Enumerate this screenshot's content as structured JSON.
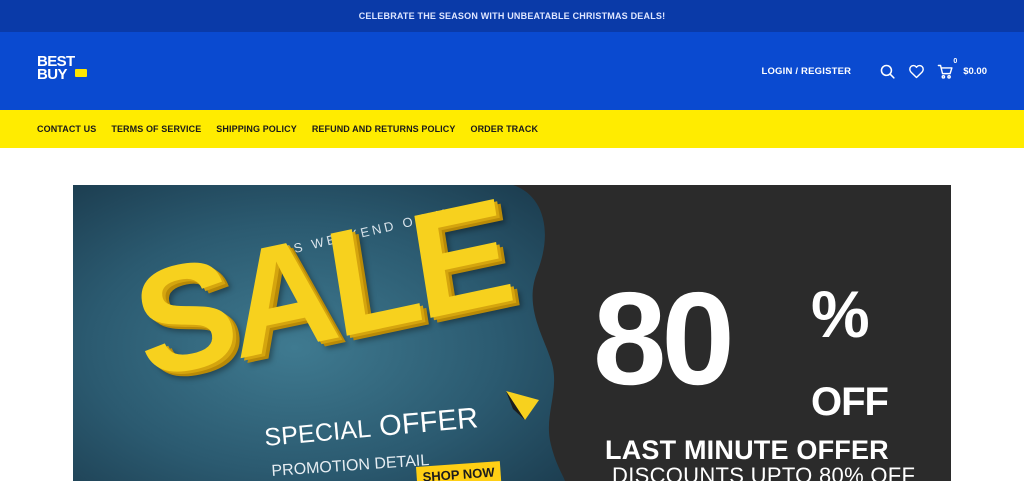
{
  "announcement": "CELEBRATE THE SEASON WITH UNBEATABLE CHRISTMAS DEALS!",
  "logo": {
    "line1": "BEST",
    "line2": "BUY"
  },
  "header": {
    "login_label": "LOGIN / REGISTER",
    "cart_count": "0",
    "cart_total": "$0.00"
  },
  "nav": {
    "items": [
      {
        "label": "CONTACT US"
      },
      {
        "label": "TERMS OF SERVICE"
      },
      {
        "label": "SHIPPING POLICY"
      },
      {
        "label": "REFUND AND RETURNS POLICY"
      },
      {
        "label": "ORDER TRACK"
      }
    ]
  },
  "banner": {
    "weekend": "THIS WEEKEND ONLY",
    "sale": "SALE",
    "special_prefix": "SPECIAL",
    "special_offer": "OFFER",
    "promotion": "PROMOTION DETAIL",
    "shop_now": "SHOP NOW",
    "big_number": "80",
    "percent": "%",
    "off": "OFF",
    "last_minute": "LAST MINUTE OFFER",
    "discounts": "DISCOUNTS UPTO 80% OFF"
  },
  "colors": {
    "topbar": "#0a3aa8",
    "header": "#0a4ad0",
    "nav": "#ffec00",
    "sale_yellow": "#f7d11e",
    "banner_dark": "#2b2b2b",
    "banner_teal": "#2f5c72"
  },
  "icons": [
    "search-icon",
    "heart-icon",
    "cart-icon"
  ]
}
